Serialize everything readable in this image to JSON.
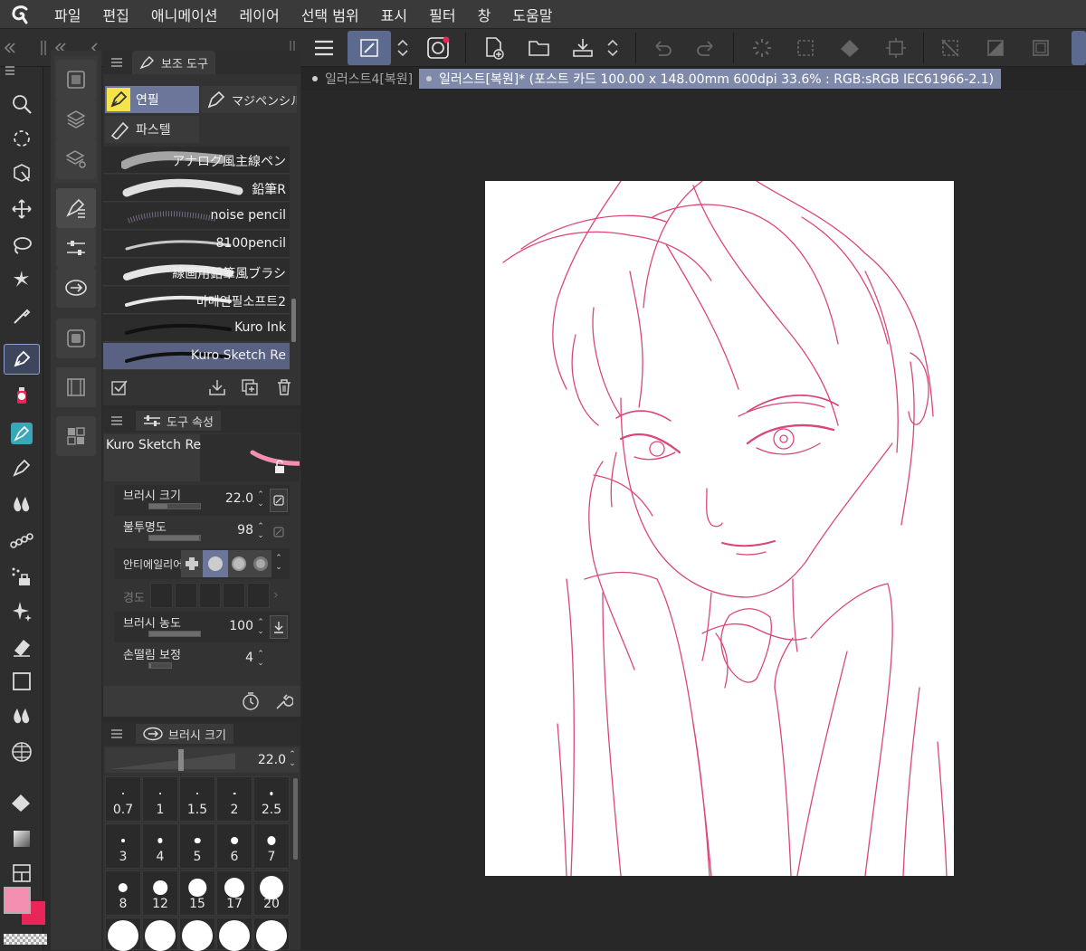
{
  "menu": [
    "파일",
    "편집",
    "애니메이션",
    "레이어",
    "선택 범위",
    "표시",
    "필터",
    "창",
    "도움말"
  ],
  "tabs": [
    {
      "label": "일러스트4[복원]",
      "active": false
    },
    {
      "label": "일러스트[복원]* (포스트 카드 100.00 x 148.00mm 600dpi 33.6% : RGB:sRGB IEC61966-2.1)",
      "active": true
    }
  ],
  "subtool_panel": {
    "title": "보조 도구",
    "groups": [
      {
        "label": "연필",
        "active": true
      },
      {
        "label": "マジペンシル",
        "active": false
      },
      {
        "label": "파스텔",
        "active": false
      }
    ],
    "brushes": [
      {
        "name": "アナログ風主線ペン",
        "active": false
      },
      {
        "name": "鉛筆R",
        "active": false
      },
      {
        "name": "noise pencil",
        "active": false
      },
      {
        "name": "8100pencil",
        "active": false
      },
      {
        "name": "線画用鉛筆風ブラシ",
        "active": false
      },
      {
        "name": "마메연필소프트2",
        "active": false
      },
      {
        "name": "Kuro Ink",
        "active": false
      },
      {
        "name": "Kuro Sketch Re",
        "active": true
      }
    ]
  },
  "tool_property": {
    "title": "도구 속성",
    "preview_name": "Kuro Sketch Re",
    "brush_size": {
      "label": "브러시 크기",
      "value": "22.0",
      "fraction": 0.35
    },
    "opacity": {
      "label": "불투명도",
      "value": "98",
      "fraction": 0.98
    },
    "antialias": {
      "label": "안티에일리어"
    },
    "hardness": {
      "label": "경도"
    },
    "density": {
      "label": "브러시 농도",
      "value": "100",
      "fraction": 1.0
    },
    "stabilization": {
      "label": "손떨림 보정",
      "value": "4",
      "fraction": 0.1
    }
  },
  "brush_size_panel": {
    "title": "브러시 크기",
    "value": "22.0",
    "fraction": 0.55,
    "presets": [
      "0.7",
      "1",
      "1.5",
      "2",
      "2.5",
      "3",
      "4",
      "5",
      "6",
      "7",
      "8",
      "12",
      "15",
      "17",
      "20"
    ]
  },
  "colors": {
    "main": "#f48fb1",
    "sub": "#e8265a",
    "accent": "#5d6a8f",
    "line": "#d6336c"
  }
}
